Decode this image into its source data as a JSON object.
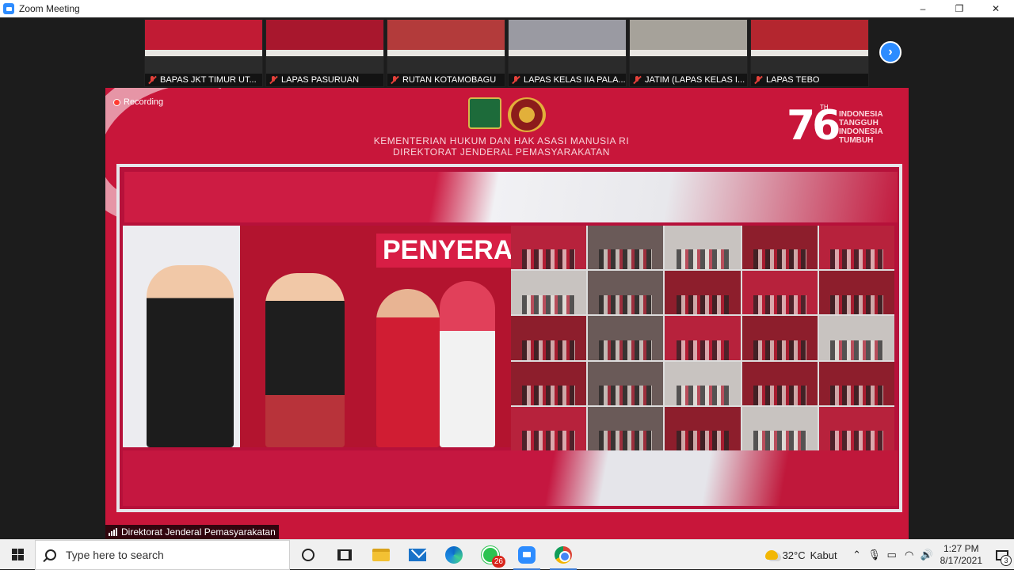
{
  "window": {
    "title": "Zoom Meeting",
    "controls": [
      "–",
      "❐",
      "✕"
    ]
  },
  "thumbnails": [
    {
      "label": "BAPAS JKT TIMUR UT...",
      "color": "#c11b34"
    },
    {
      "label": "LAPAS PASURUAN",
      "color": "#a8172d"
    },
    {
      "label": "RUTAN KOTAMOBAGU",
      "color": "#b33b3b"
    },
    {
      "label": "LAPAS KELAS IIA PALA...",
      "color": "#9a9aa2"
    },
    {
      "label": "JATIM (LAPAS KELAS I...",
      "color": "#a6a29a"
    },
    {
      "label": "LAPAS TEBO",
      "color": "#b4262f"
    }
  ],
  "main_video": {
    "recording_label": "Recording",
    "ministry_line1": "KEMENTERIAN HUKUM DAN HAK ASASI MANUSIA RI",
    "ministry_line2": "DIREKTORAT JENDERAL PEMASYARAKATAN",
    "badge_number": "76",
    "badge_th": "TH",
    "badge_line1": "INDONESIA",
    "badge_line2": "TANGGUH",
    "badge_line3": "INDONESIA",
    "badge_line4": "TUMBUH",
    "stage_banner": "PENYERAHA",
    "speaker_name": "Direktorat Jenderal Pemasyarakatan"
  },
  "taskbar": {
    "search_placeholder": "Type here to search",
    "whatsapp_badge": "26",
    "weather_temp": "32°C",
    "weather_desc": "Kabut",
    "time": "1:27 PM",
    "date": "8/17/2021",
    "notification_count": "3"
  }
}
